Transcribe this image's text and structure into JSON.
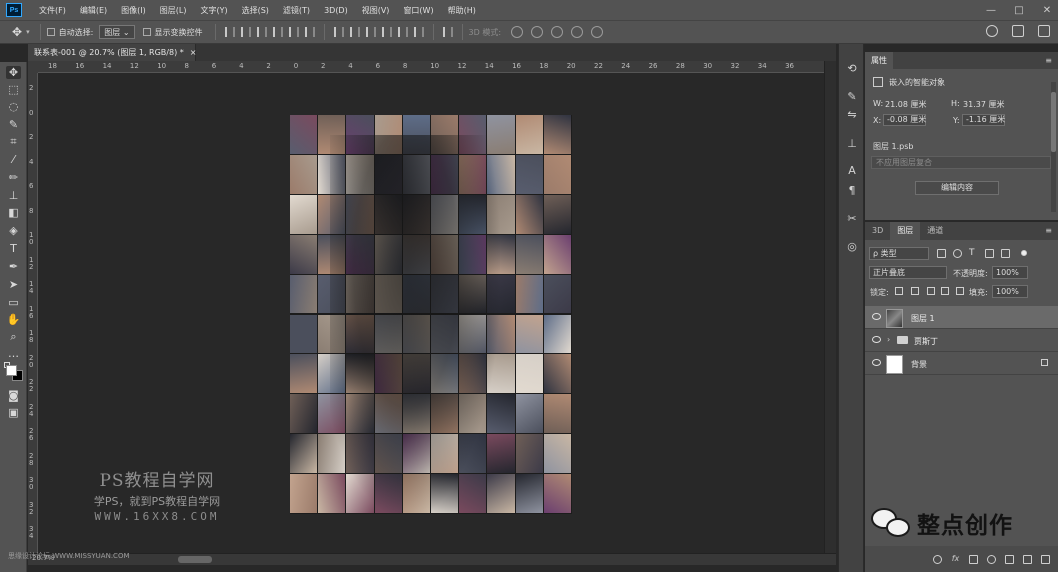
{
  "app": {
    "logo": "Ps",
    "menu": [
      "文件(F)",
      "编辑(E)",
      "图像(I)",
      "图层(L)",
      "文字(Y)",
      "选择(S)",
      "滤镜(T)",
      "3D(D)",
      "视图(V)",
      "窗口(W)",
      "帮助(H)"
    ],
    "window_controls": [
      "—",
      "□",
      "✕"
    ]
  },
  "options": {
    "auto_select_label": "自动选择:",
    "auto_select_value": "图层",
    "show_transform_label": "显示变换控件",
    "mode3d_label": "3D 模式:"
  },
  "document": {
    "tab_title": "联系表-001 @ 20.7% (图层 1, RGB/8) *",
    "close": "×",
    "status": "20.7%"
  },
  "rulers": {
    "h_labels": [
      "18",
      "16",
      "14",
      "12",
      "10",
      "8",
      "6",
      "4",
      "2",
      "0",
      "2",
      "4",
      "6",
      "8",
      "10",
      "12",
      "14",
      "16",
      "18",
      "20",
      "22",
      "24",
      "26",
      "28",
      "30",
      "32",
      "34",
      "36"
    ],
    "v_labels": [
      "2",
      "0",
      "2",
      "4",
      "6",
      "8",
      "1\n0",
      "1\n2",
      "1\n4",
      "1\n6",
      "1\n8",
      "2\n0",
      "2\n2",
      "2\n4",
      "2\n6",
      "2\n8",
      "3\n0",
      "3\n2",
      "3\n4"
    ]
  },
  "watermarks": {
    "left_title": "PS教程自学网",
    "left_sub": "学PS，就到PS教程自学网",
    "left_url": "WWW.16XX8.COM",
    "bottom": "思缘设计论坛 WWW.MISSYUAN.COM",
    "wechat": "整点创作"
  },
  "properties": {
    "tab": "属性",
    "menu": "≡",
    "type": "嵌入的智能对象",
    "w_label": "W:",
    "w_value": "21.08 厘米",
    "h_label": "H:",
    "h_value": "31.37 厘米",
    "x_label": "X:",
    "x_value": "-0.08 厘米",
    "y_label": "Y:",
    "y_value": "-1.16 厘米",
    "file": "图层 1.psb",
    "comp": "不应用图层复合",
    "edit_button": "编辑内容"
  },
  "layers_panel": {
    "tabs": [
      "3D",
      "图层",
      "通道"
    ],
    "active_tab": 1,
    "menu": "≡",
    "filter_kind": "ρ 类型",
    "blend_mode": "正片叠底",
    "opacity_label": "不透明度:",
    "opacity_value": "100%",
    "lock_label": "锁定:",
    "fill_label": "填充:",
    "fill_value": "100%",
    "layers": [
      {
        "name": "图层 1",
        "kind": "smart",
        "selected": true
      },
      {
        "name": "贾斯丁",
        "kind": "group",
        "selected": false
      },
      {
        "name": "背景",
        "kind": "background",
        "selected": false
      }
    ],
    "footer_icons": [
      "link-icon",
      "fx-icon",
      "mask-icon",
      "adjustment-icon",
      "group-icon",
      "new-layer-icon",
      "trash-icon"
    ],
    "footer_fx": "fx"
  },
  "tools": [
    "move-tool",
    "marquee-tool",
    "lasso-tool",
    "quick-select-tool",
    "crop-tool",
    "eyedropper-tool",
    "brush-tool",
    "stamp-tool",
    "eraser-tool",
    "bucket-tool",
    "type-tool",
    "pen-tool",
    "path-select-tool",
    "rectangle-tool",
    "hand-tool",
    "zoom-tool",
    "more-tools",
    "color-swatches",
    "quick-mask",
    "screen-mode"
  ]
}
